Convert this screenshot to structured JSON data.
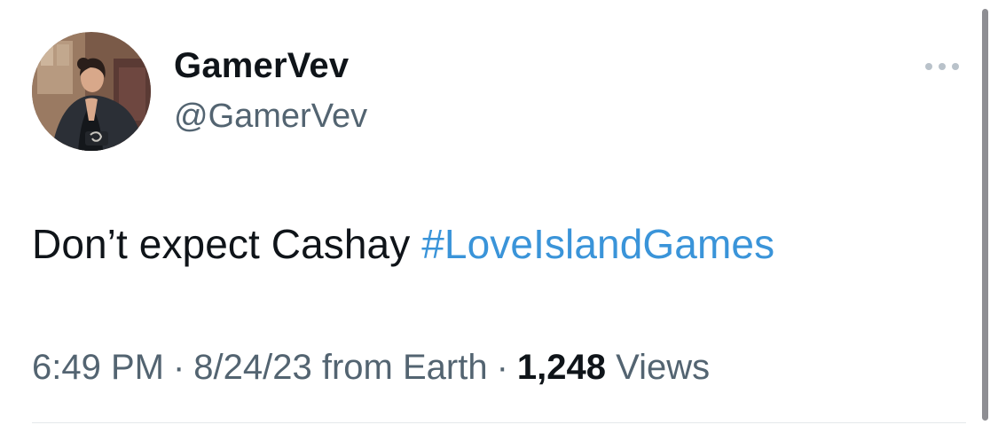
{
  "tweet": {
    "author": {
      "display_name": "GamerVev",
      "handle": "@GamerVev"
    },
    "text_plain": "Don’t expect Cashay ",
    "hashtag": "#LoveIslandGames",
    "meta": {
      "time": "6:49 PM",
      "separator": "·",
      "date_source": "8/24/23 from Earth",
      "views_count": "1,248",
      "views_label": "Views"
    }
  },
  "colors": {
    "hashtag": "#3a94d9",
    "secondary_text": "#536471",
    "primary_text": "#0f1419"
  },
  "icons": {
    "more": "more-horizontal-icon"
  }
}
